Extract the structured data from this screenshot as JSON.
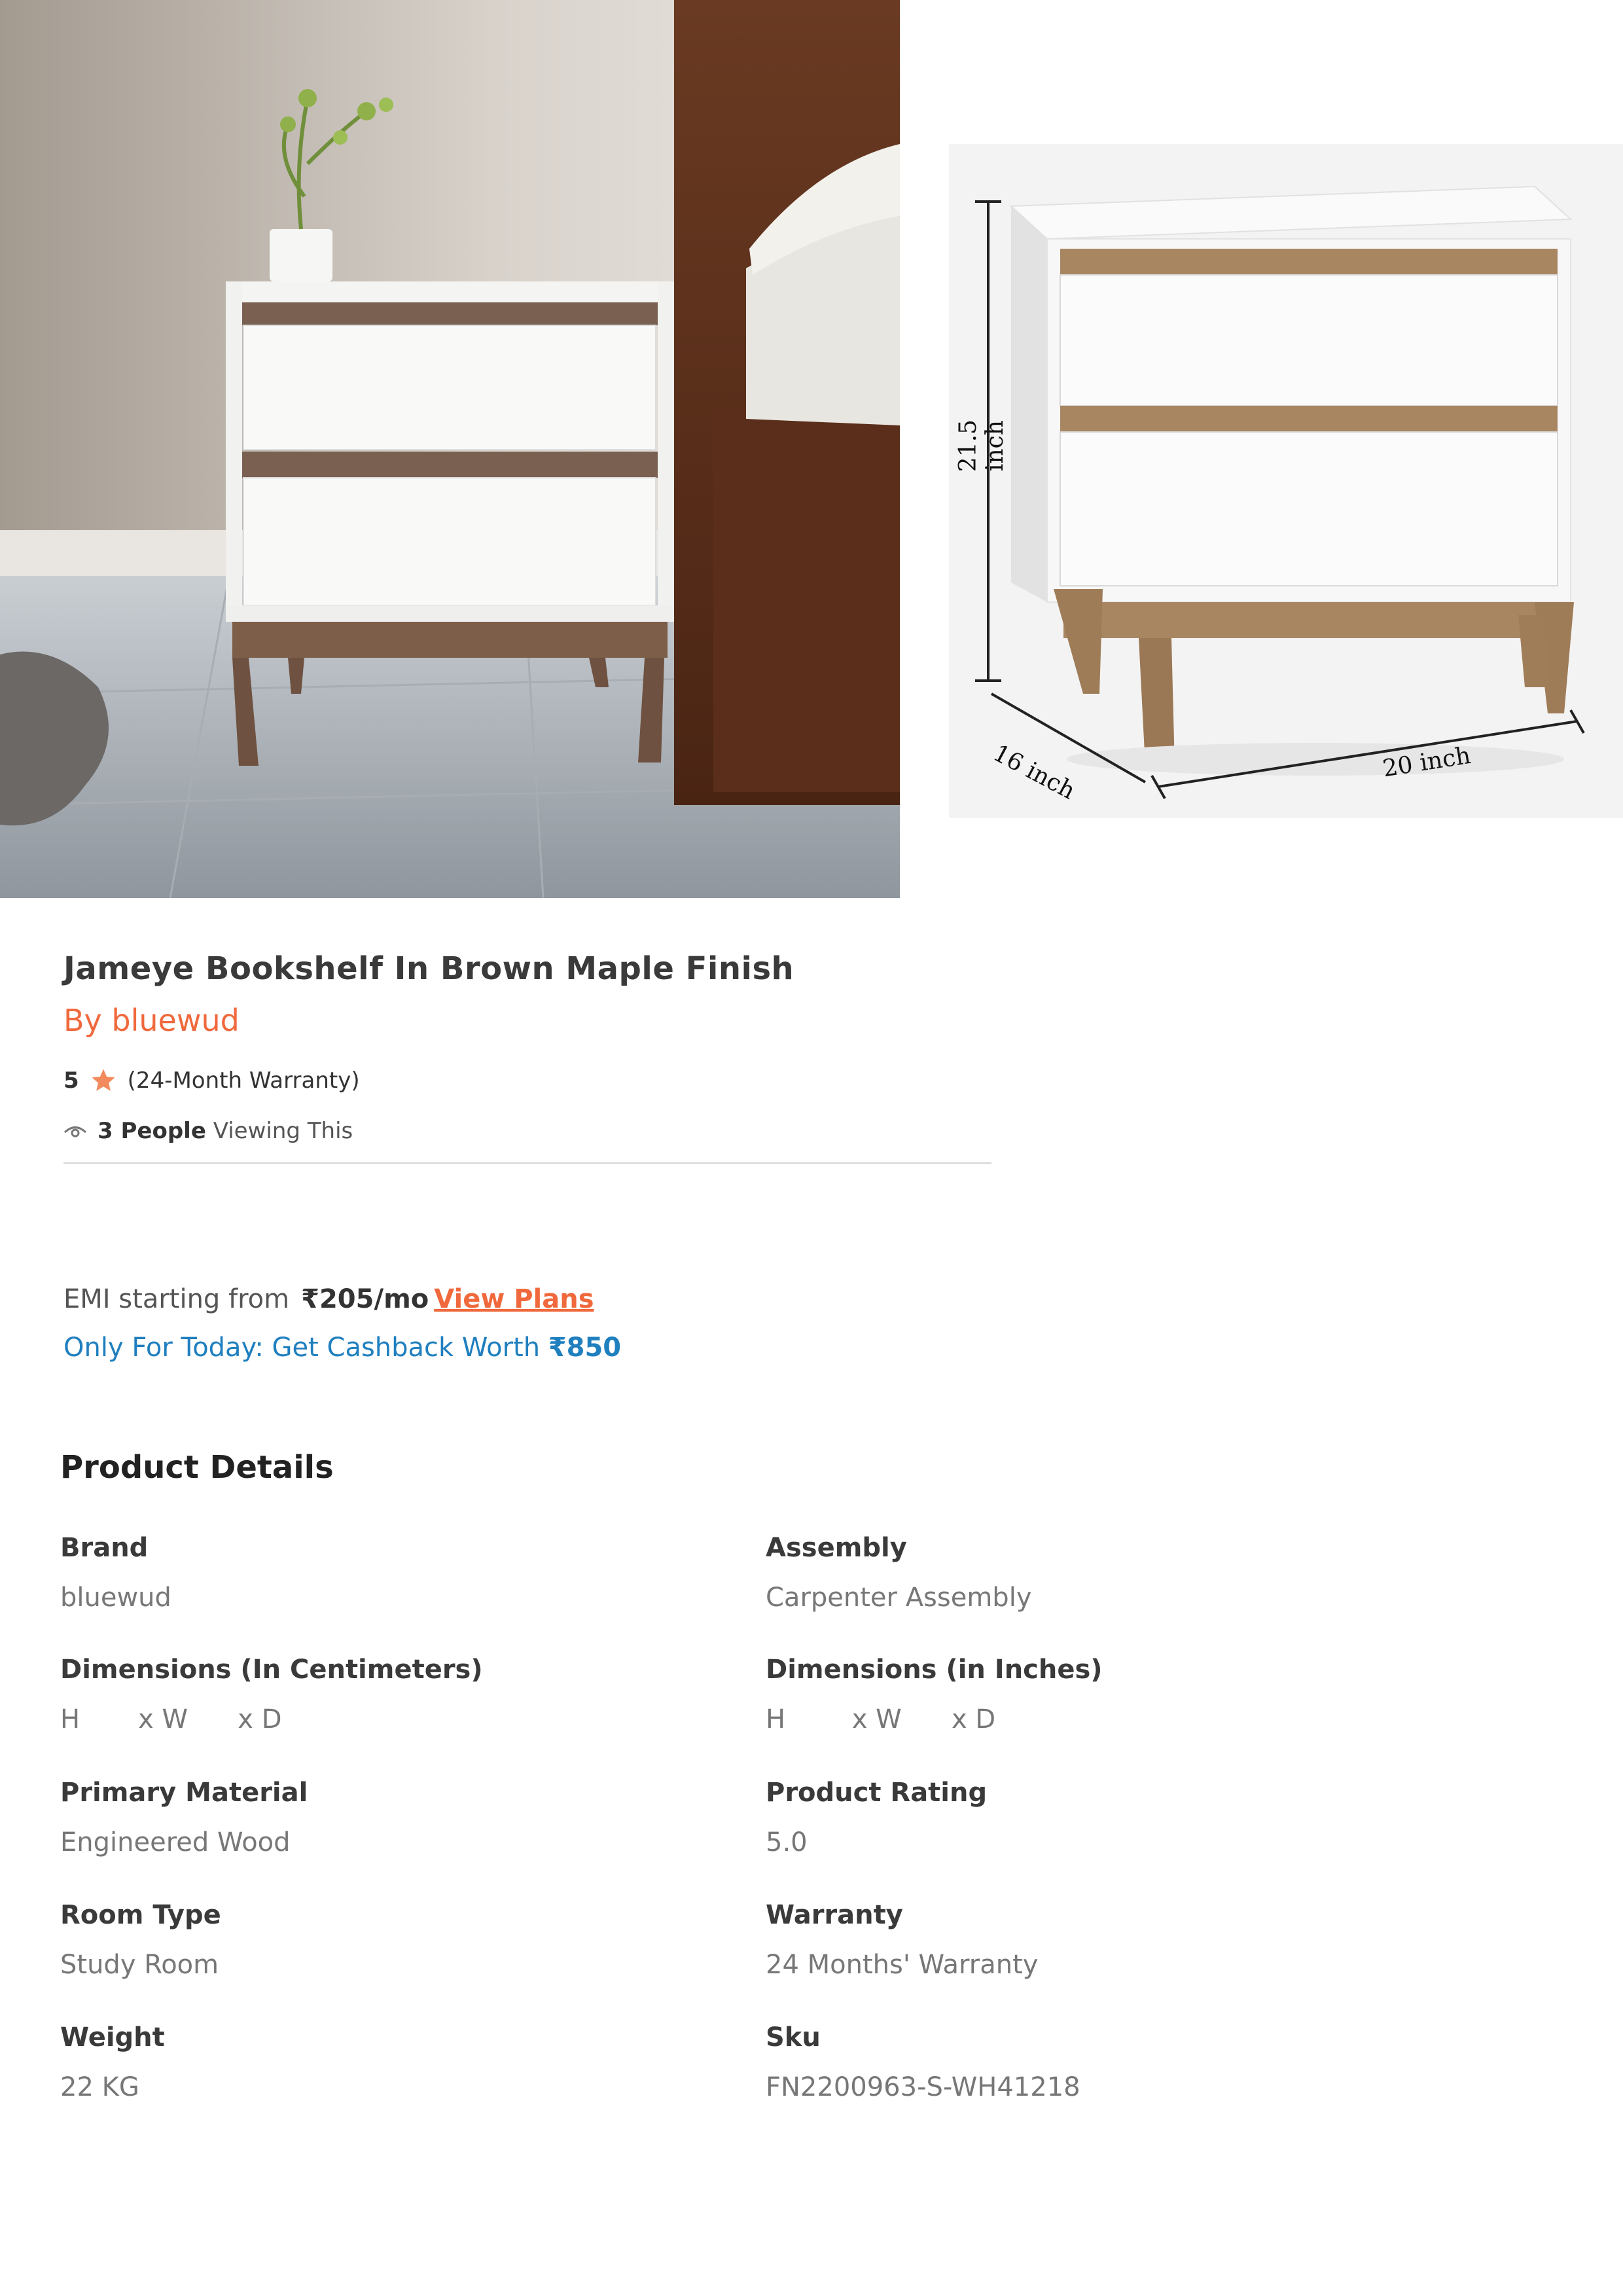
{
  "product": {
    "title": "Jameye Bookshelf In Brown Maple Finish",
    "brand_line": "By bluewud",
    "rating": "5",
    "warranty_note": "(24-Month Warranty)",
    "viewing_count": "3 People",
    "viewing_suffix": "Viewing This"
  },
  "gallery": {
    "dimension_labels": {
      "height": "21.5 inch",
      "depth": "16 inch",
      "width": "20 inch"
    }
  },
  "offers": {
    "emi_prefix": "EMI starting from",
    "emi_price": "₹205/mo",
    "emi_link": "View Plans",
    "cashback_text": "Only For Today: Get Cashback Worth",
    "cashback_amount": "₹850"
  },
  "details": {
    "heading": "Product Details",
    "items": [
      {
        "label": "Brand",
        "value": "bluewud"
      },
      {
        "label": "Assembly",
        "value": "Carpenter Assembly"
      },
      {
        "label": "Dimensions (In Centimeters)",
        "value": "H       x W      x D"
      },
      {
        "label": "Dimensions (in Inches)",
        "value": "H        x W      x D"
      },
      {
        "label": "Primary Material",
        "value": "Engineered Wood"
      },
      {
        "label": "Product Rating",
        "value": "5.0"
      },
      {
        "label": "Room Type",
        "value": "Study Room"
      },
      {
        "label": "Warranty",
        "value": "24 Months' Warranty"
      },
      {
        "label": "Weight",
        "value": "22 KG"
      },
      {
        "label": "Sku",
        "value": "FN2200963-S-WH41218"
      }
    ]
  },
  "colors": {
    "accent_orange": "#f0693c",
    "link_blue": "#1f7fbf",
    "star": "#f28a5e"
  }
}
